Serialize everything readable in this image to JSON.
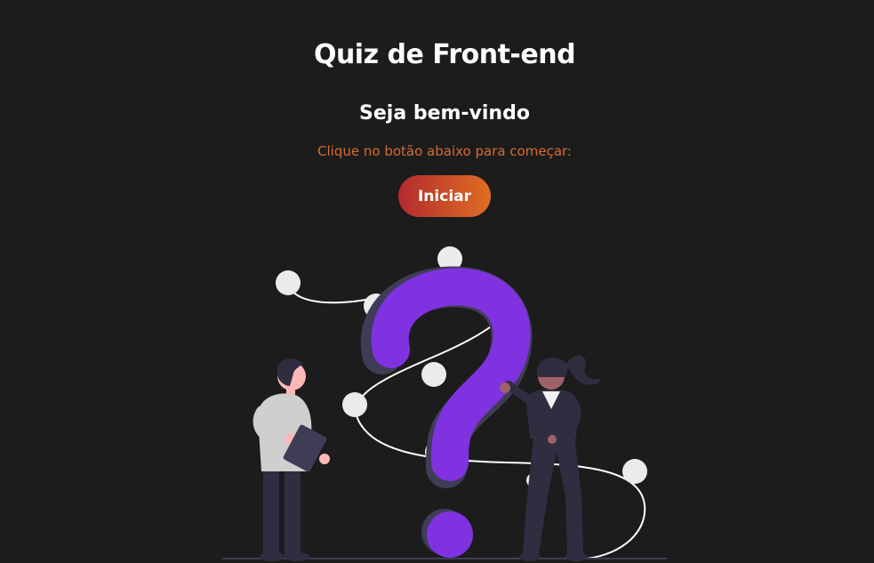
{
  "page": {
    "title": "Quiz de Front-end",
    "welcome": "Seja bem-vindo",
    "instruction": "Clique no botão abaixo para começar:",
    "start_button_label": "Iniciar"
  },
  "colors": {
    "background": "#1c1c1d",
    "accent_text": "#d96a2e",
    "button_gradient_start": "#b22b2f",
    "button_gradient_end": "#e06d22",
    "question_mark": "#8032e0"
  },
  "illustration": {
    "icon": "question-people-illustration"
  }
}
